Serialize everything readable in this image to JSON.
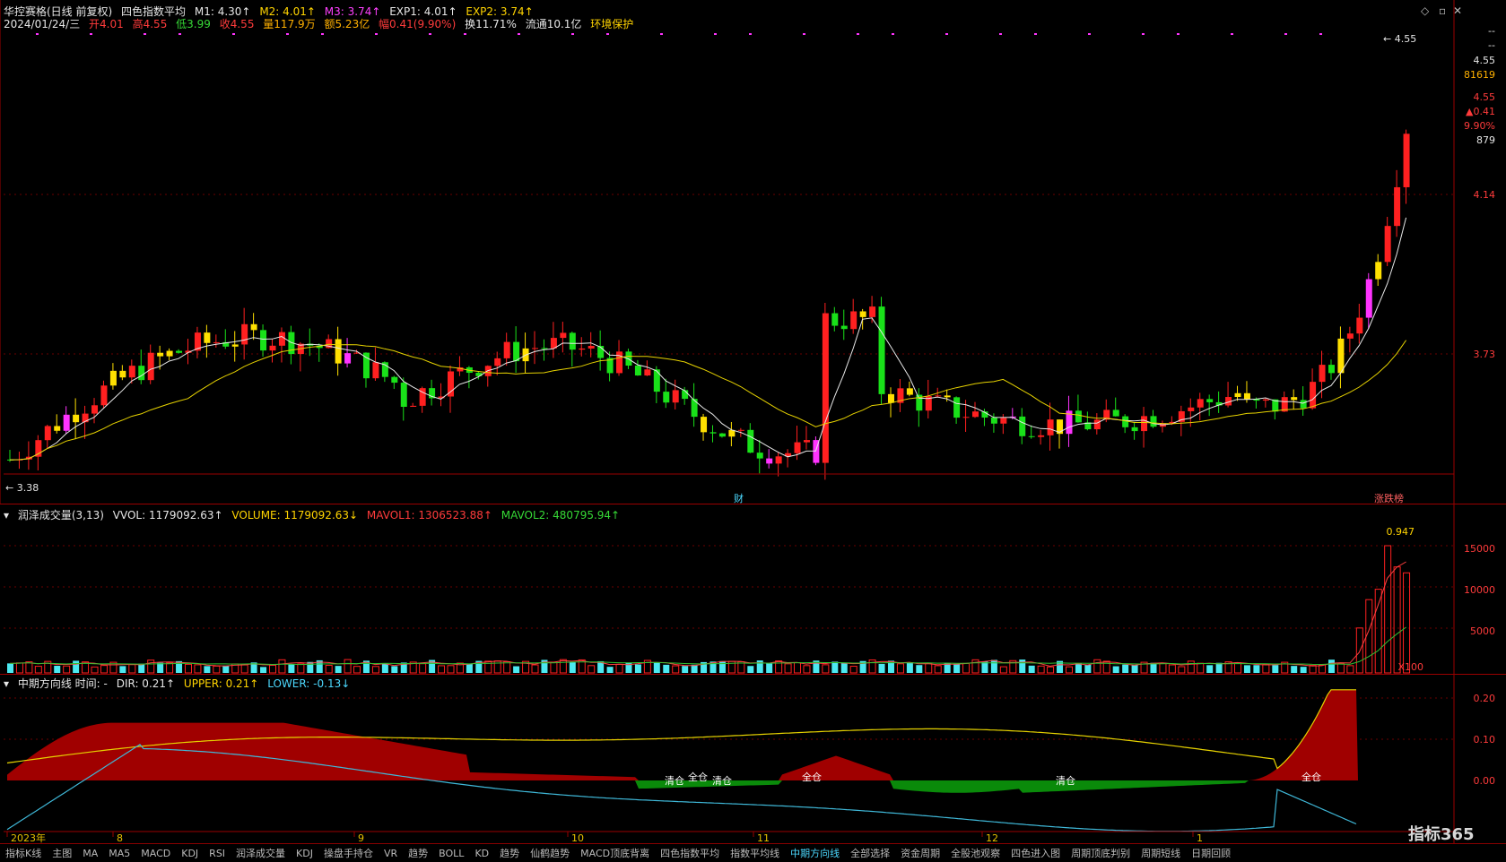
{
  "header": {
    "stock_name": "华控赛格(日线 前复权)",
    "indicator_name": "四色指数平均",
    "m1": "M1: 4.30↑",
    "m2": "M2: 4.01↑",
    "m3": "M3: 3.74↑",
    "exp1": "EXP1: 4.01↑",
    "exp2": "EXP2: 3.74↑",
    "date": "2024/01/24/三",
    "open": "开4.01",
    "high": "高4.55",
    "low": "低3.99",
    "close": "收4.55",
    "volume": "量117.9万",
    "amount": "额5.23亿",
    "change": "幅0.41(9.90%)",
    "turnover": "换11.71%",
    "float": "流通10.1亿",
    "env": "环境保护"
  },
  "right_axis": {
    "dash1": "--",
    "dash2": "--",
    "price_last": "4.55",
    "volume_last": "81619",
    "price_red": "4.55",
    "change_abs": "▲0.41",
    "change_pct": "9.90%",
    "count": "879",
    "tick_414": "4.14",
    "tick_373": "3.73",
    "tick_vol_15000": "15000",
    "tick_vol_10000": "10000",
    "tick_vol_5000": "5000",
    "vol_unit": "X100",
    "tick_dir_020": "0.20",
    "tick_dir_010": "0.10",
    "tick_dir_000": "0.00",
    "period": "日线"
  },
  "markers": {
    "high_label": "4.55",
    "low_label": "3.38",
    "cai": "财",
    "zdb": "涨跌榜"
  },
  "volume_header": {
    "name": "润泽成交量(3,13)",
    "vvol": "VVOL: 1179092.63↑",
    "volume": "VOLUME: 1179092.63↓",
    "mavol1": "MAVOL1: 1306523.88↑",
    "mavol2": "MAVOL2: 480795.94↑",
    "ratio": "0.947"
  },
  "dir_header": {
    "name": "中期方向线 时间: -",
    "dir": "DIR: 0.21↑",
    "upper": "UPPER: 0.21↑",
    "lower": "LOWER: -0.13↓"
  },
  "dir_labels": [
    "清仓",
    "全仓",
    "清仓",
    "全仓",
    "清仓",
    "全仓"
  ],
  "x_axis": [
    "2023年",
    "8",
    "9",
    "10",
    "11",
    "12",
    "1"
  ],
  "tabs": [
    "指标K线",
    "主图",
    "MA",
    "MA5",
    "MACD",
    "KDJ",
    "RSI",
    "润泽成交量",
    "KDJ",
    "操盘手持仓",
    "VR",
    "趋势",
    "BOLL",
    "KD",
    "趋势",
    "仙鹤趋势",
    "MACD顶底背离",
    "四色指数平均",
    "指数平均线",
    "中期方向线",
    "全部选择",
    "资金周期",
    "全股池观察",
    "四色进入图",
    "周期顶底判别",
    "周期短线",
    "日期回顾"
  ],
  "watermark": "指标365",
  "colors": {
    "up": "#ff2020",
    "down": "#19e119",
    "yellow": "#ffe000",
    "magenta": "#ff33ff",
    "ma1": "#e8e8e8",
    "ma2": "#e6d200",
    "vol_up": "#4ce8f0",
    "dir_fill": "#a00000",
    "dir_green": "#0a8a0a"
  }
}
